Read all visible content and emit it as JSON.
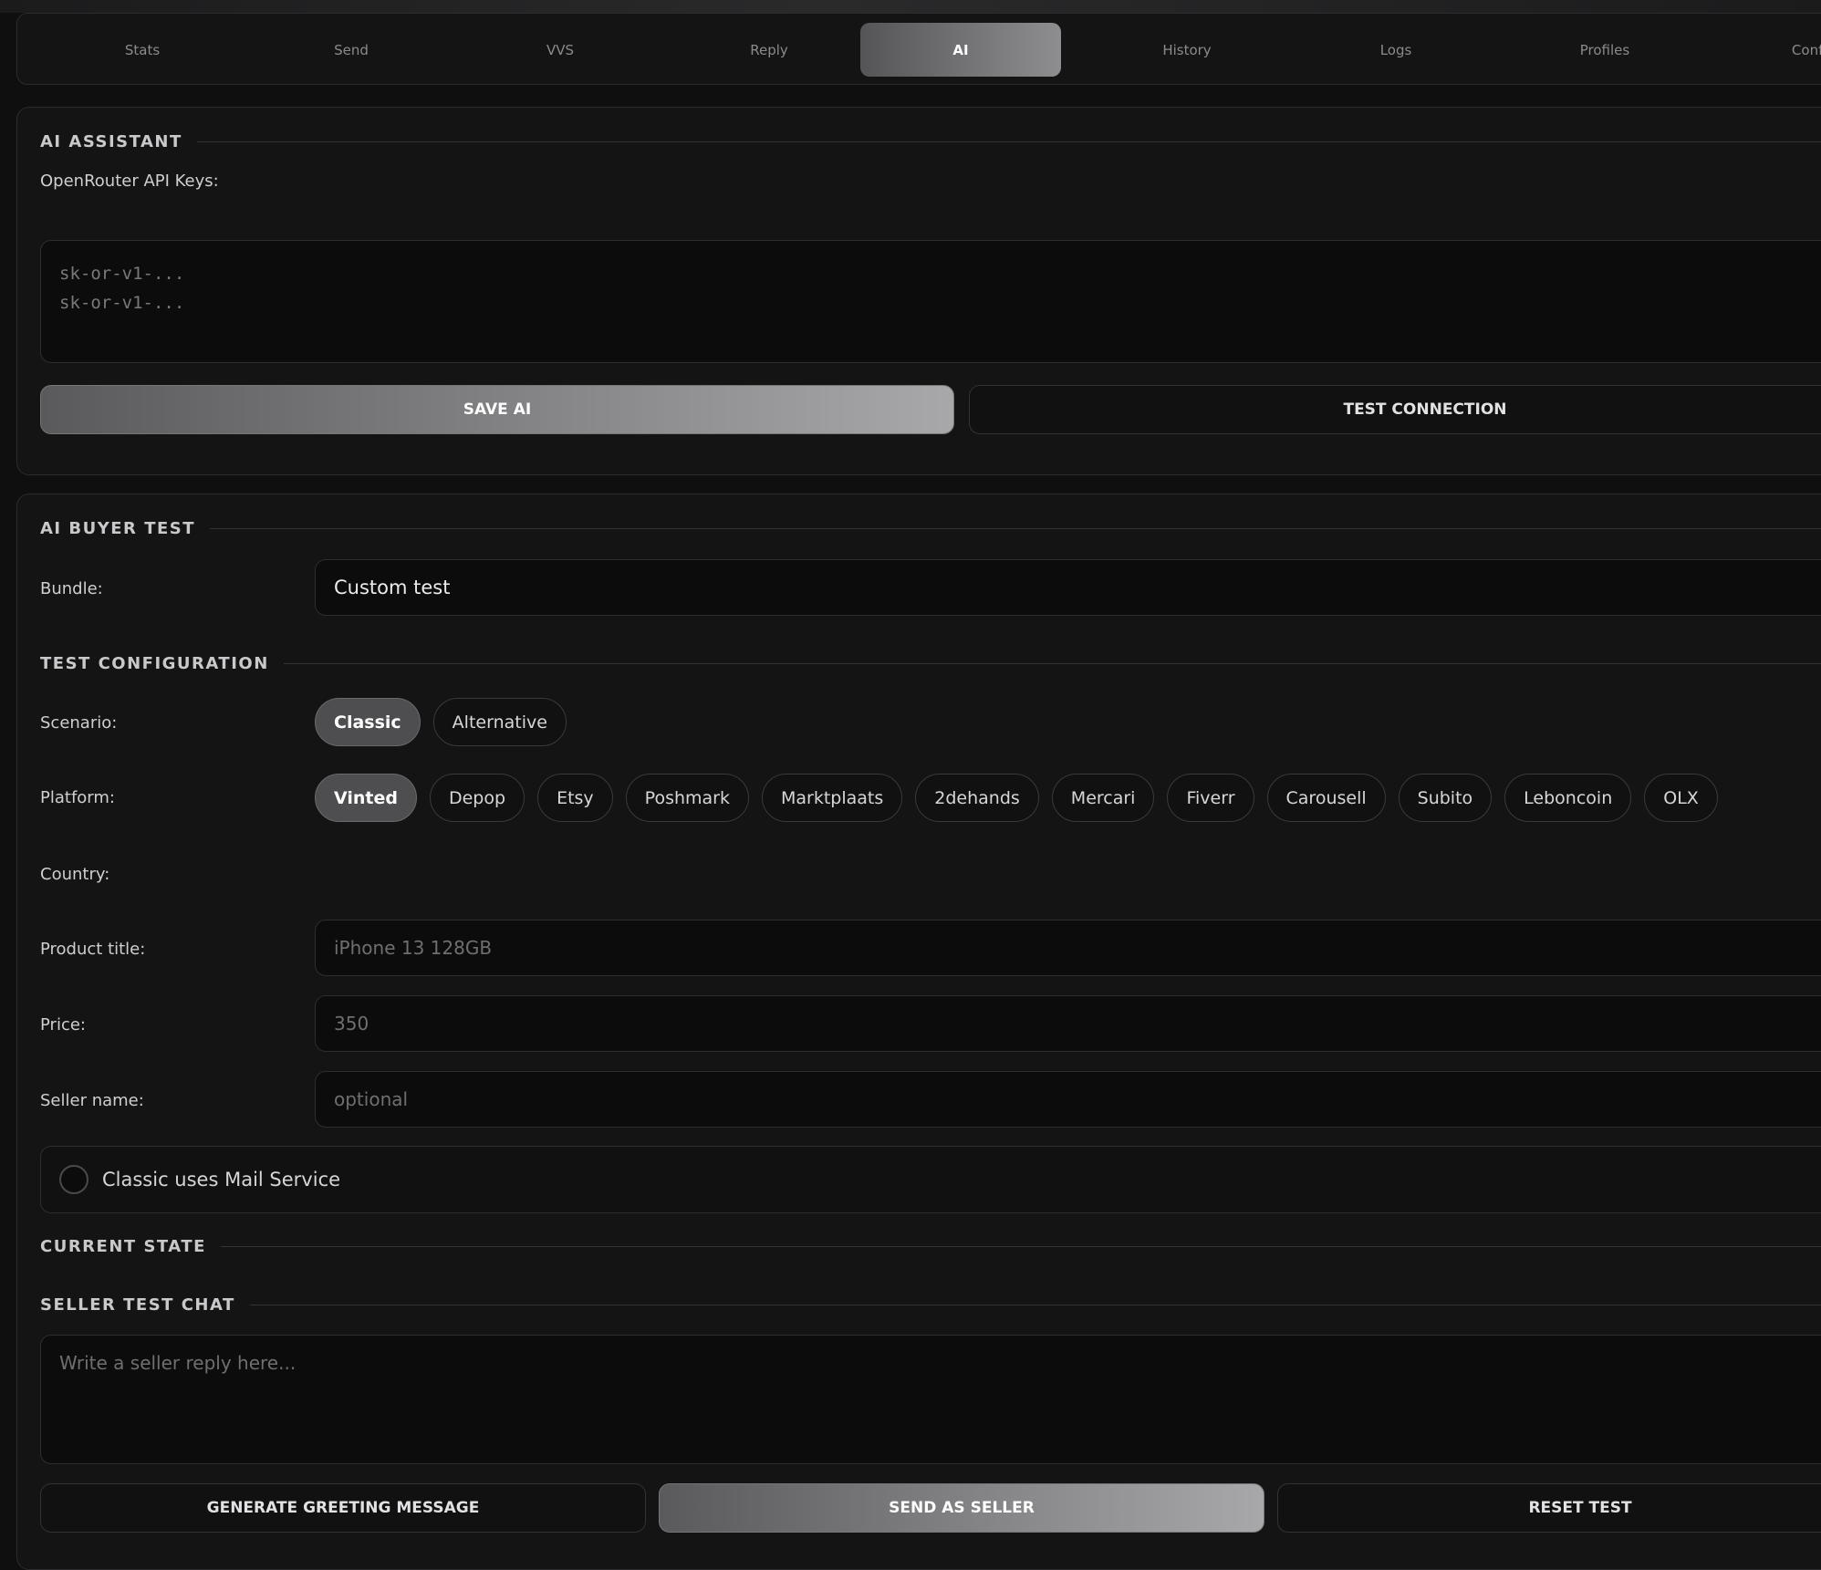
{
  "tabs": [
    "Stats",
    "Send",
    "VVS",
    "Reply",
    "AI",
    "History",
    "Logs",
    "Profiles",
    "Config"
  ],
  "active_tab": "AI",
  "ai_assistant": {
    "title": "AI ASSISTANT",
    "keys_label": "OpenRouter API Keys:",
    "keys_placeholder_lines": [
      "sk-or-v1-...",
      "sk-or-v1-..."
    ],
    "save_label": "SAVE AI",
    "test_label": "TEST CONNECTION"
  },
  "buyer_test": {
    "title": "AI BUYER TEST",
    "bundle_label": "Bundle:",
    "bundle_value": "Custom test",
    "config_title": "TEST CONFIGURATION",
    "scenario_label": "Scenario:",
    "scenarios": [
      "Classic",
      "Alternative"
    ],
    "scenario_selected": "Classic",
    "platform_label": "Platform:",
    "platforms": [
      "Vinted",
      "Depop",
      "Etsy",
      "Poshmark",
      "Marktplaats",
      "2dehands",
      "Mercari",
      "Fiverr",
      "Carousell",
      "Subito",
      "Leboncoin",
      "OLX"
    ],
    "platform_selected": "Vinted",
    "country_label": "Country:",
    "product_label": "Product title:",
    "product_placeholder": "iPhone 13 128GB",
    "price_label": "Price:",
    "price_placeholder": "350",
    "seller_label": "Seller name:",
    "seller_placeholder": "optional",
    "mail_service_label": "Classic uses Mail Service",
    "mail_service_checked": false,
    "state_title": "CURRENT STATE",
    "chat_title": "SELLER TEST CHAT",
    "chat_placeholder": "Write a seller reply here...",
    "greeting_label": "GENERATE GREETING MESSAGE",
    "send_label": "SEND AS SELLER",
    "reset_label": "RESET TEST"
  }
}
